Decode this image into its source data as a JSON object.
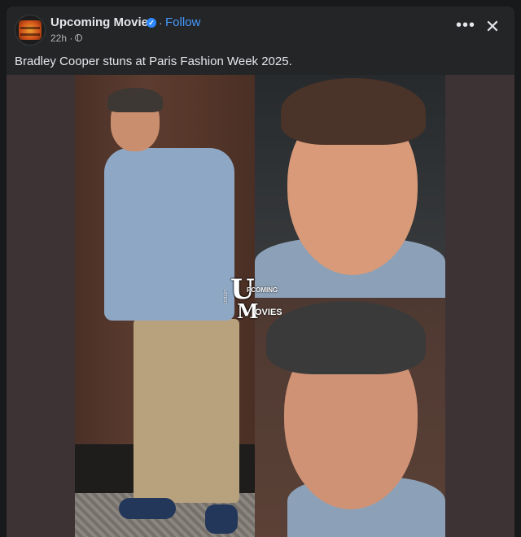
{
  "post": {
    "page_name": "Upcoming Movies",
    "verified_icon": "verified-badge-icon",
    "separator": "·",
    "follow_label": "Follow",
    "time": "22h ·",
    "audience_icon": "globe-icon",
    "caption": "Bradley Cooper stuns at Paris Fashion Week 2025."
  },
  "actions": {
    "more_label": "•••",
    "close_label": "✕"
  },
  "avatar": {
    "logo_text": "UPCOMING MOVIES"
  },
  "media": {
    "watermark": {
      "u": "U",
      "pcoming": "PCOMING",
      "m": "M",
      "ovies": "OVIES",
      "side": "LATEST"
    }
  }
}
